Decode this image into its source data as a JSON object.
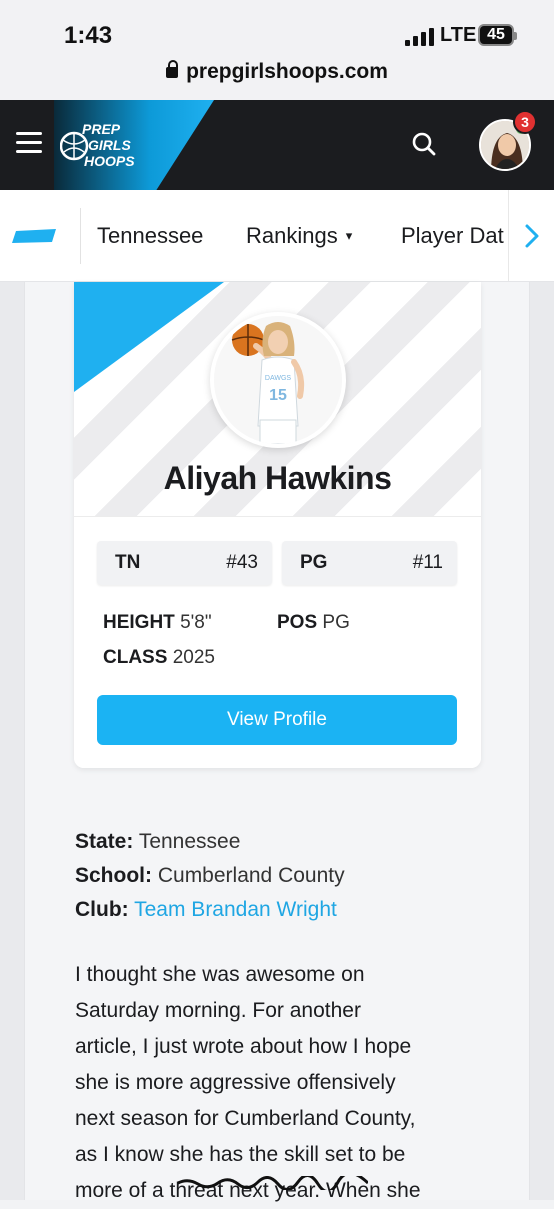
{
  "status_bar": {
    "time": "1:43",
    "network": "LTE",
    "battery": "45",
    "url": "prepgirlshoops.com"
  },
  "header": {
    "logo_line1": "PREP",
    "logo_line2": "GIRLS",
    "logo_line3": "HOOPS",
    "notification_count": "3",
    "accent": "#1fb0f0"
  },
  "subnav": {
    "items": [
      {
        "label": "Tennessee"
      },
      {
        "label": "Rankings",
        "chevron": "▾"
      },
      {
        "label": "Player Dat"
      }
    ],
    "next_icon": "›"
  },
  "player_card": {
    "name": "Aliyah Hawkins",
    "jersey_number": "15",
    "rank_boxes": [
      {
        "label": "TN",
        "value": "#43"
      },
      {
        "label": "PG",
        "value": "#11"
      }
    ],
    "height_label": "HEIGHT",
    "height_value": "5'8\"",
    "pos_label": "POS",
    "pos_value": "PG",
    "class_label": "CLASS",
    "class_value": "2025",
    "button_label": "View Profile"
  },
  "meta": {
    "state_label": "State:",
    "state_value": "Tennessee",
    "school_label": "School:",
    "school_value": "Cumberland County",
    "club_label": "Club:",
    "club_value": "Team Brandan Wright"
  },
  "article": {
    "lines": [
      "I thought she was awesome on",
      "Saturday morning.  For another",
      "article, I just wrote about how I hope",
      "she is more aggressive offensively",
      "next season for Cumberland County,",
      "as I know she has the skill set to be",
      "more of a threat next year.  When she"
    ]
  }
}
